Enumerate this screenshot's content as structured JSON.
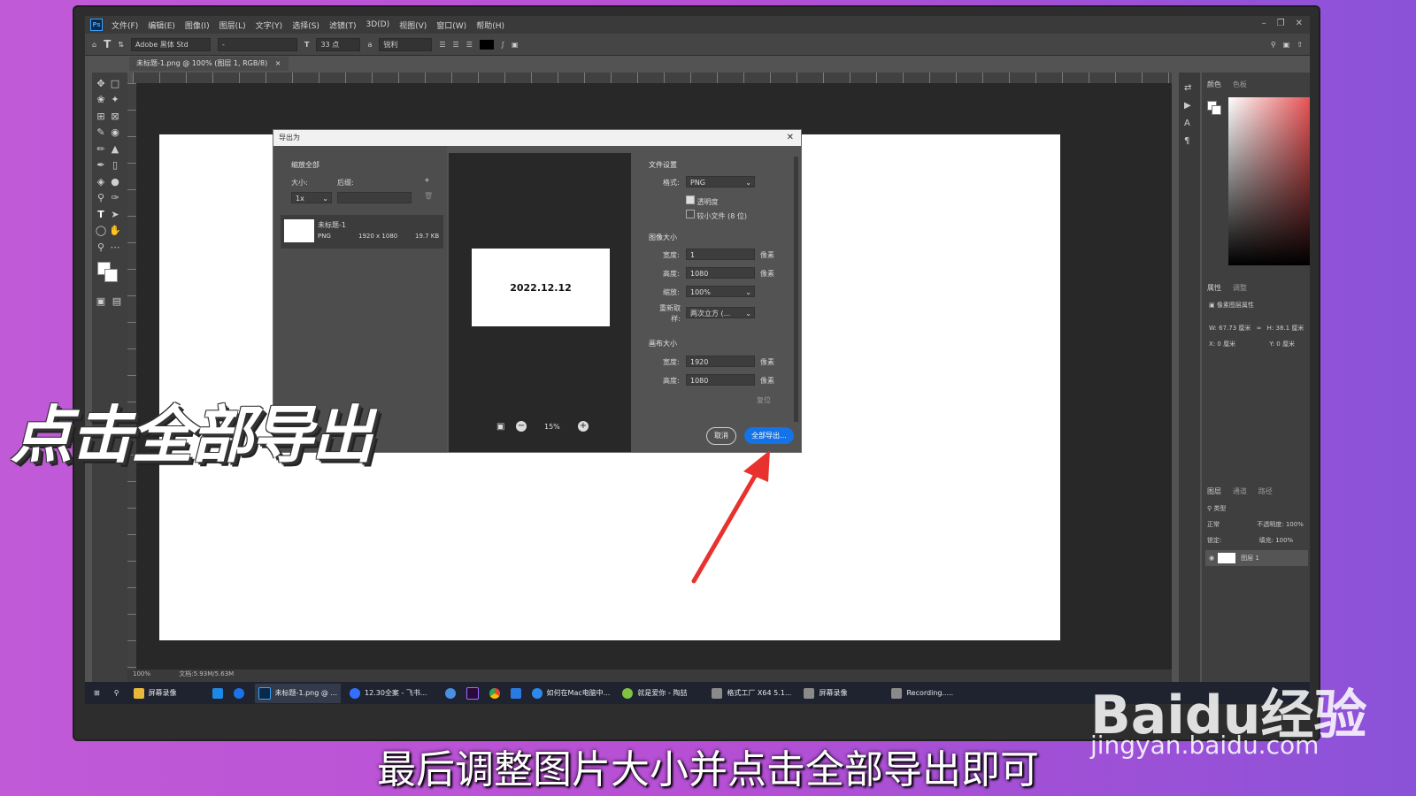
{
  "app": {
    "menus": [
      "文件(F)",
      "编辑(E)",
      "图像(I)",
      "图层(L)",
      "文字(Y)",
      "选择(S)",
      "滤镜(T)",
      "3D(D)",
      "视图(V)",
      "窗口(W)",
      "帮助(H)"
    ],
    "options": {
      "font": "Adobe 黑体 Std",
      "style": "-",
      "size": "33 点",
      "antialias": "锐利"
    },
    "doc_tab": "未标题-1.png @ 100% (图层 1, RGB/8)",
    "status": {
      "zoom": "100%",
      "doc": "文档:5.93M/5.63M"
    }
  },
  "dialog": {
    "title": "导出为",
    "left": {
      "section": "缩放全部",
      "size_label": "大小:",
      "suffix_label": "后缀:",
      "scale_value": "1x",
      "file_name": "未标题-1",
      "file_type": "PNG",
      "file_dims": "1920 x 1080",
      "file_size": "19.7 KB"
    },
    "preview": {
      "text": "2022.12.12",
      "zoom": "15%"
    },
    "file_settings": {
      "section": "文件设置",
      "format_label": "格式:",
      "format_value": "PNG",
      "transparency": "透明度",
      "smaller_file": "较小文件 (8 位)"
    },
    "image_size": {
      "section": "图像大小",
      "width_label": "宽度:",
      "width_value": "1",
      "height_label": "高度:",
      "height_value": "1080",
      "scale_label": "缩放:",
      "scale_value": "100%",
      "resample_label": "重新取样:",
      "resample_value": "两次立方 (...",
      "unit": "像素"
    },
    "canvas_size": {
      "section": "画布大小",
      "width_label": "宽度:",
      "width_value": "1920",
      "height_label": "高度:",
      "height_value": "1080",
      "unit": "像素",
      "reset": "复位"
    },
    "cancel": "取消",
    "export_all": "全部导出..."
  },
  "panels": {
    "color_tabs": [
      "颜色",
      "色板"
    ],
    "props_tabs": [
      "属性",
      "调整"
    ],
    "props_title": "像素图层属性",
    "w": "67.73 厘米",
    "h": "38.1 厘米",
    "x": "0 厘米",
    "y": "0 厘米",
    "layers_tabs": [
      "图层",
      "通道",
      "路径"
    ],
    "kind": "类型",
    "blend": "正常",
    "opacity_label": "不透明度:",
    "opacity": "100%",
    "lock_label": "锁定:",
    "fill_label": "填充:",
    "fill": "100%",
    "layer_name": "图层 1"
  },
  "taskbar": [
    "屏幕录像",
    "未标题-1.png @ ...",
    "12.30全案 - 飞书...",
    "如何在Mac电脑中...",
    "就是爱你 - 陶喆",
    "格式工厂 X64 5.1...",
    "屏幕录像",
    "Recording....."
  ],
  "overlay": {
    "caption": "点击全部导出",
    "subtitle": "最后调整图片大小并点击全部导出即可",
    "watermark": "Baidu经验",
    "watermark_url": "jingyan.baidu.com"
  },
  "colors": {
    "accent": "#1473e6",
    "arrow": "#e8322d"
  }
}
